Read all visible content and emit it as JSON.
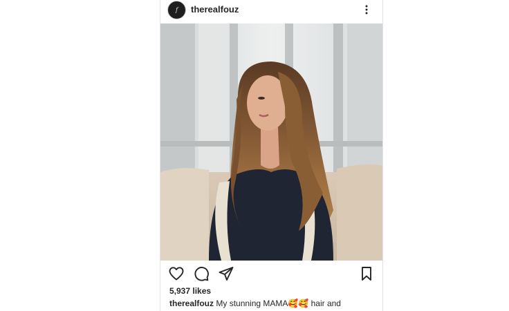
{
  "post": {
    "username": "therealfouz",
    "likes": "5,937 likes",
    "caption_username": "therealfouz",
    "caption_text": "My stunning MAMA🥰🥰 hair and"
  },
  "icons": {
    "avatar": "avatar",
    "more": "more-options-icon",
    "like": "heart-icon",
    "comment": "comment-icon",
    "share": "send-icon",
    "save": "bookmark-icon"
  },
  "colors": {
    "text": "#262626",
    "icon": "#262626",
    "divider": "#e3e3e3"
  }
}
